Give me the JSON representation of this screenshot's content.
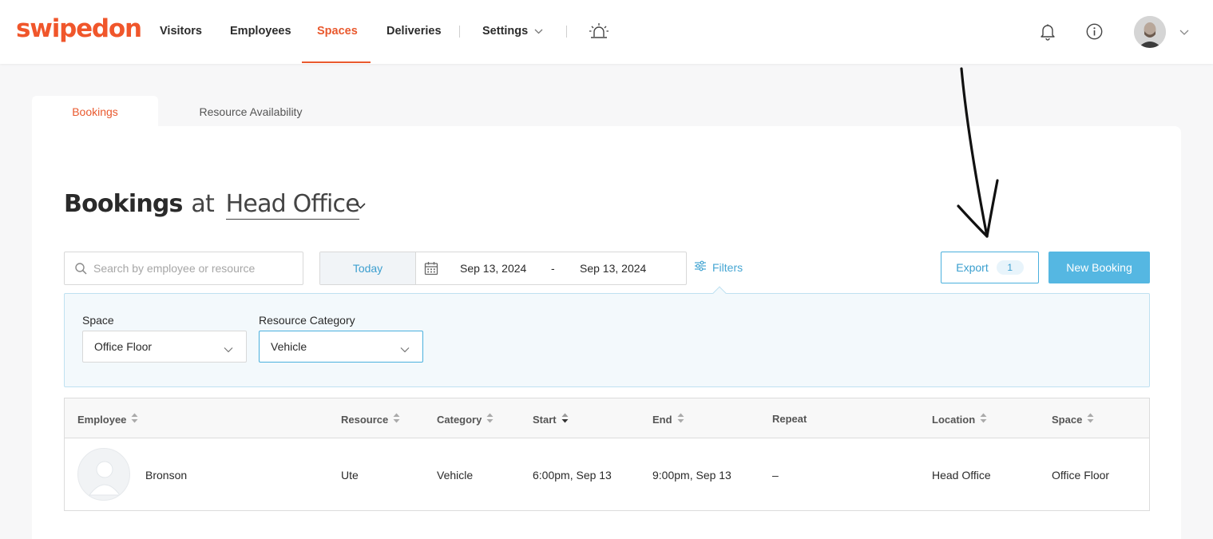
{
  "brand": {
    "logo_text": "swipedon",
    "accent": "#e9592e",
    "primary_blue": "#55b7e2"
  },
  "nav": {
    "items": [
      {
        "label": "Visitors",
        "active": false
      },
      {
        "label": "Employees",
        "active": false
      },
      {
        "label": "Spaces",
        "active": true
      },
      {
        "label": "Deliveries",
        "active": false
      },
      {
        "label": "Settings",
        "active": false
      }
    ],
    "icons": [
      "chevron-down-icon",
      "alarm-icon",
      "bell-icon",
      "info-icon",
      "avatar",
      "chevron-down-icon"
    ]
  },
  "tabs": [
    {
      "label": "Bookings",
      "active": true
    },
    {
      "label": "Resource Availability",
      "active": false
    }
  ],
  "page": {
    "title_strong": "Bookings",
    "title_at": "at",
    "location": "Head Office"
  },
  "toolbar": {
    "search_placeholder": "Search by employee or resource",
    "today_label": "Today",
    "date_start": "Sep 13, 2024",
    "date_separator": "-",
    "date_end": "Sep 13, 2024",
    "filters_label": "Filters",
    "export_label": "Export",
    "export_count": "1",
    "new_booking_label": "New Booking"
  },
  "filters": {
    "space_label": "Space",
    "space_value": "Office Floor",
    "category_label": "Resource Category",
    "category_value": "Vehicle"
  },
  "table": {
    "columns": [
      "Employee",
      "Resource",
      "Category",
      "Start",
      "End",
      "Repeat",
      "Location",
      "Space"
    ],
    "rows": [
      {
        "employee": "Bronson",
        "resource": "Ute",
        "category": "Vehicle",
        "start": "6:00pm, Sep 13",
        "end": "9:00pm, Sep 13",
        "repeat": "–",
        "location": "Head Office",
        "space": "Office Floor"
      }
    ]
  }
}
